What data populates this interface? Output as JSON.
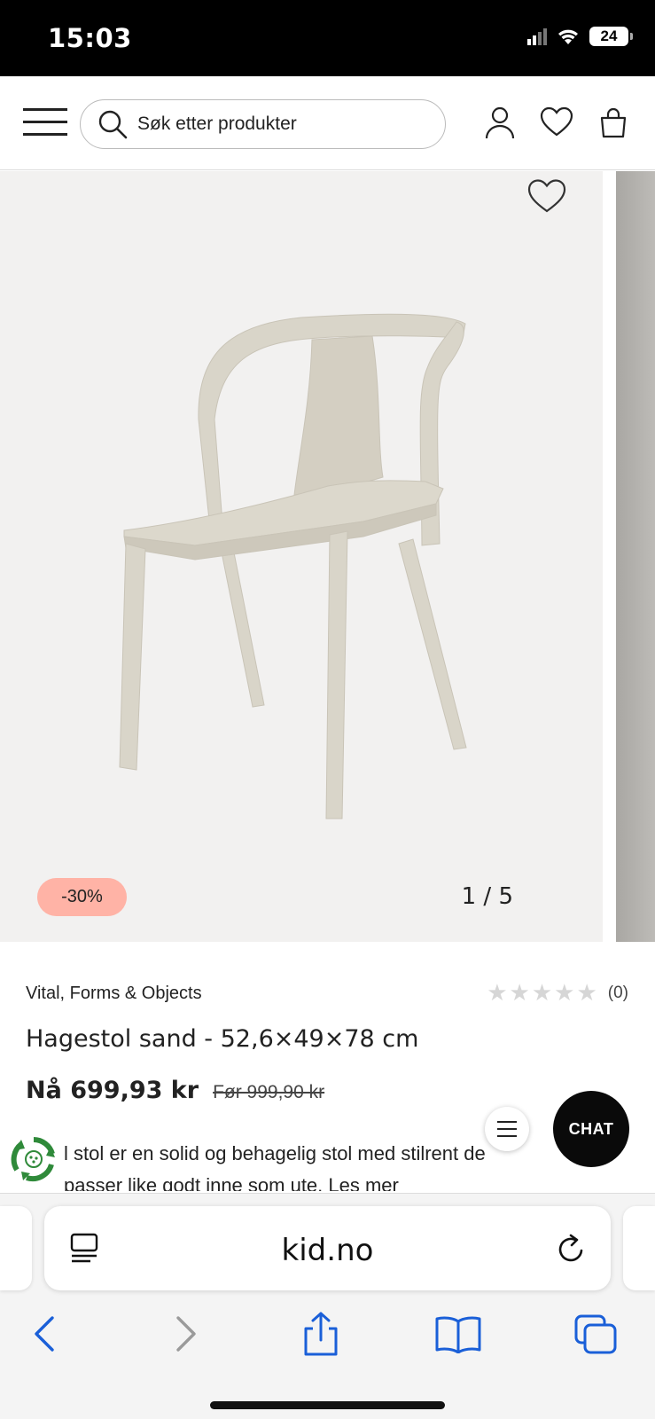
{
  "status_bar": {
    "time": "15:03",
    "battery": "24"
  },
  "header": {
    "search": {
      "placeholder": "Søk etter produkter"
    }
  },
  "gallery": {
    "discount_badge": "-30%",
    "counter": "1 / 5"
  },
  "product": {
    "brand": "Vital, Forms & Objects",
    "rating_stars": 0,
    "rating_count": "(0)",
    "title": "Hagestol sand - 52,6×49×78 cm",
    "price_now": "Nå 699,93 kr",
    "price_before": "Før 999,90 kr",
    "description_line1": "l stol er en solid og behagelig stol med stilrent de",
    "description_line2": "passer like godt inne som ute. Les mer"
  },
  "chat_button": "CHAT",
  "browser": {
    "url": "kid.no"
  },
  "colors": {
    "discount_badge_bg": "#ffb3a6",
    "chat_bg": "#0a0a0a",
    "browser_accent": "#1a5fd8",
    "chair": "#d9d5c9"
  }
}
